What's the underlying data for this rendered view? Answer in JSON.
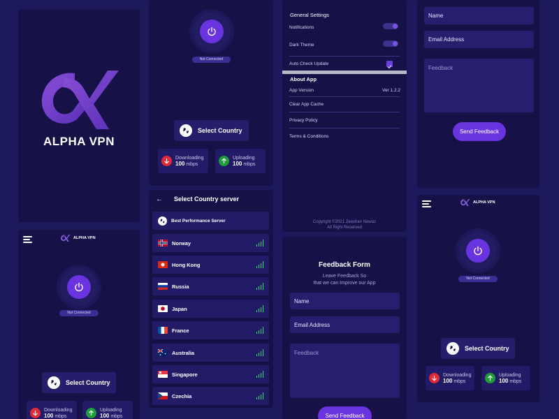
{
  "brand": {
    "logo_text": "ALPHA VPN",
    "header_title": "ALPHA VPN"
  },
  "home": {
    "status": "Not Connected",
    "select_label": "Select Country",
    "download_label": "Downloading",
    "download_value": "100",
    "download_unit": "mbps",
    "upload_label": "Uploading",
    "upload_value": "100",
    "upload_unit": "mbps"
  },
  "countries_screen": {
    "title": "Select Country server",
    "best": "Best Performance Server",
    "items": [
      {
        "name": "Norway"
      },
      {
        "name": "Hong Kong"
      },
      {
        "name": "Russia"
      },
      {
        "name": "Japan"
      },
      {
        "name": "France"
      },
      {
        "name": "Australia"
      },
      {
        "name": "Singapore"
      },
      {
        "name": "Czechia"
      }
    ]
  },
  "settings": {
    "general_heading": "General Settings",
    "notifications": "Notifications",
    "dark_theme": "Dark Theme",
    "auto_update": "Auto Check Update",
    "about_heading": "About App",
    "app_version_label": "App Version",
    "app_version_value": "Ver 1.2.2",
    "clear_cache": "Clear App Cache",
    "privacy": "Privacy Policy",
    "terms": "Terms & Conditions",
    "copyright_1": "Copyright ©2021 Zeeshan Nawaz",
    "copyright_2": "All Right Reserved",
    "notifications_on": true,
    "dark_theme_on": true,
    "auto_update_checked": true
  },
  "feedback": {
    "title": "Feedback Form",
    "subtitle_1": "Leave Feedback So",
    "subtitle_2": "that we can Improve our App",
    "name_placeholder": "Name",
    "email_placeholder": "Email Address",
    "feedback_placeholder": "Feedback",
    "send": "Send Feedback"
  },
  "colors": {
    "background": "#1c1a5c",
    "panel": "#161248",
    "accent": "#6a33e0",
    "download": "#e02a38",
    "upload": "#1f9d3a",
    "signal": "#3dde66"
  }
}
